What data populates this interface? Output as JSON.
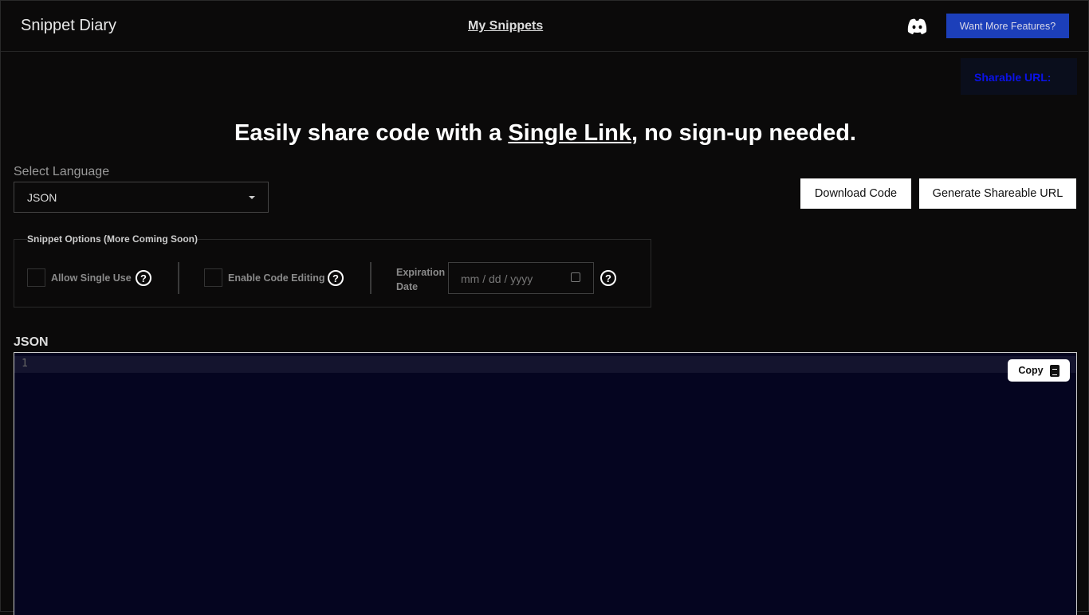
{
  "nav": {
    "brand": "Snippet Diary",
    "my_snippets": "My Snippets",
    "more_features": "Want More Features?",
    "discord_icon": "discord-icon"
  },
  "share": {
    "label": "Sharable URL:",
    "color": "#0b12e8"
  },
  "hero": {
    "before": "Easily share code with a ",
    "link": "Single Link",
    "after": ", no sign-up needed."
  },
  "language": {
    "label": "Select Language",
    "value": "JSON"
  },
  "actions": {
    "download": "Download Code",
    "generate": "Generate Shareable URL"
  },
  "options": {
    "legend": "Snippet Options (More Coming Soon)",
    "single_use": "Allow Single Use",
    "code_editing": "Enable Code Editing",
    "expiration_line1": "Expiration",
    "expiration_line2": "Date",
    "date_placeholder": "mm / dd / yyyy",
    "help": "?"
  },
  "editor": {
    "label": "JSON",
    "line_number": "1",
    "copy": "Copy"
  }
}
